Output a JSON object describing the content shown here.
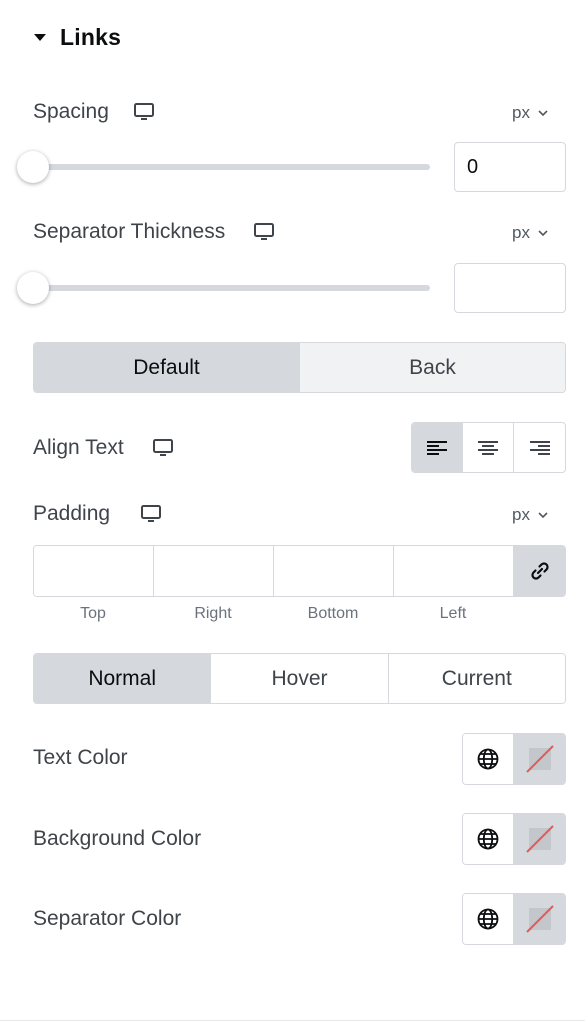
{
  "section": {
    "title": "Links"
  },
  "spacing": {
    "label": "Spacing",
    "unit": "px",
    "value": "0",
    "slider_level": 0
  },
  "separator_thickness": {
    "label": "Separator Thickness",
    "unit": "px",
    "value": "",
    "slider_level": 0
  },
  "state_tabs_1": {
    "items": [
      "Default",
      "Back"
    ],
    "active": "Default"
  },
  "align_text": {
    "label": "Align Text",
    "options": [
      "left",
      "center",
      "right"
    ],
    "active": "left"
  },
  "padding": {
    "label": "Padding",
    "unit": "px",
    "sides": [
      "Top",
      "Right",
      "Bottom",
      "Left"
    ],
    "linked": true
  },
  "state_tabs_2": {
    "items": [
      "Normal",
      "Hover",
      "Current"
    ],
    "active": "Normal"
  },
  "colors": [
    {
      "label": "Text Color"
    },
    {
      "label": "Background Color"
    },
    {
      "label": "Separator Color"
    }
  ],
  "theme": {
    "active_bg": "#d5d8dc",
    "border": "#d5d8dc",
    "text": "#3f444b",
    "heading": "#0c0d0e",
    "clear_slash": "#e45b5b"
  }
}
